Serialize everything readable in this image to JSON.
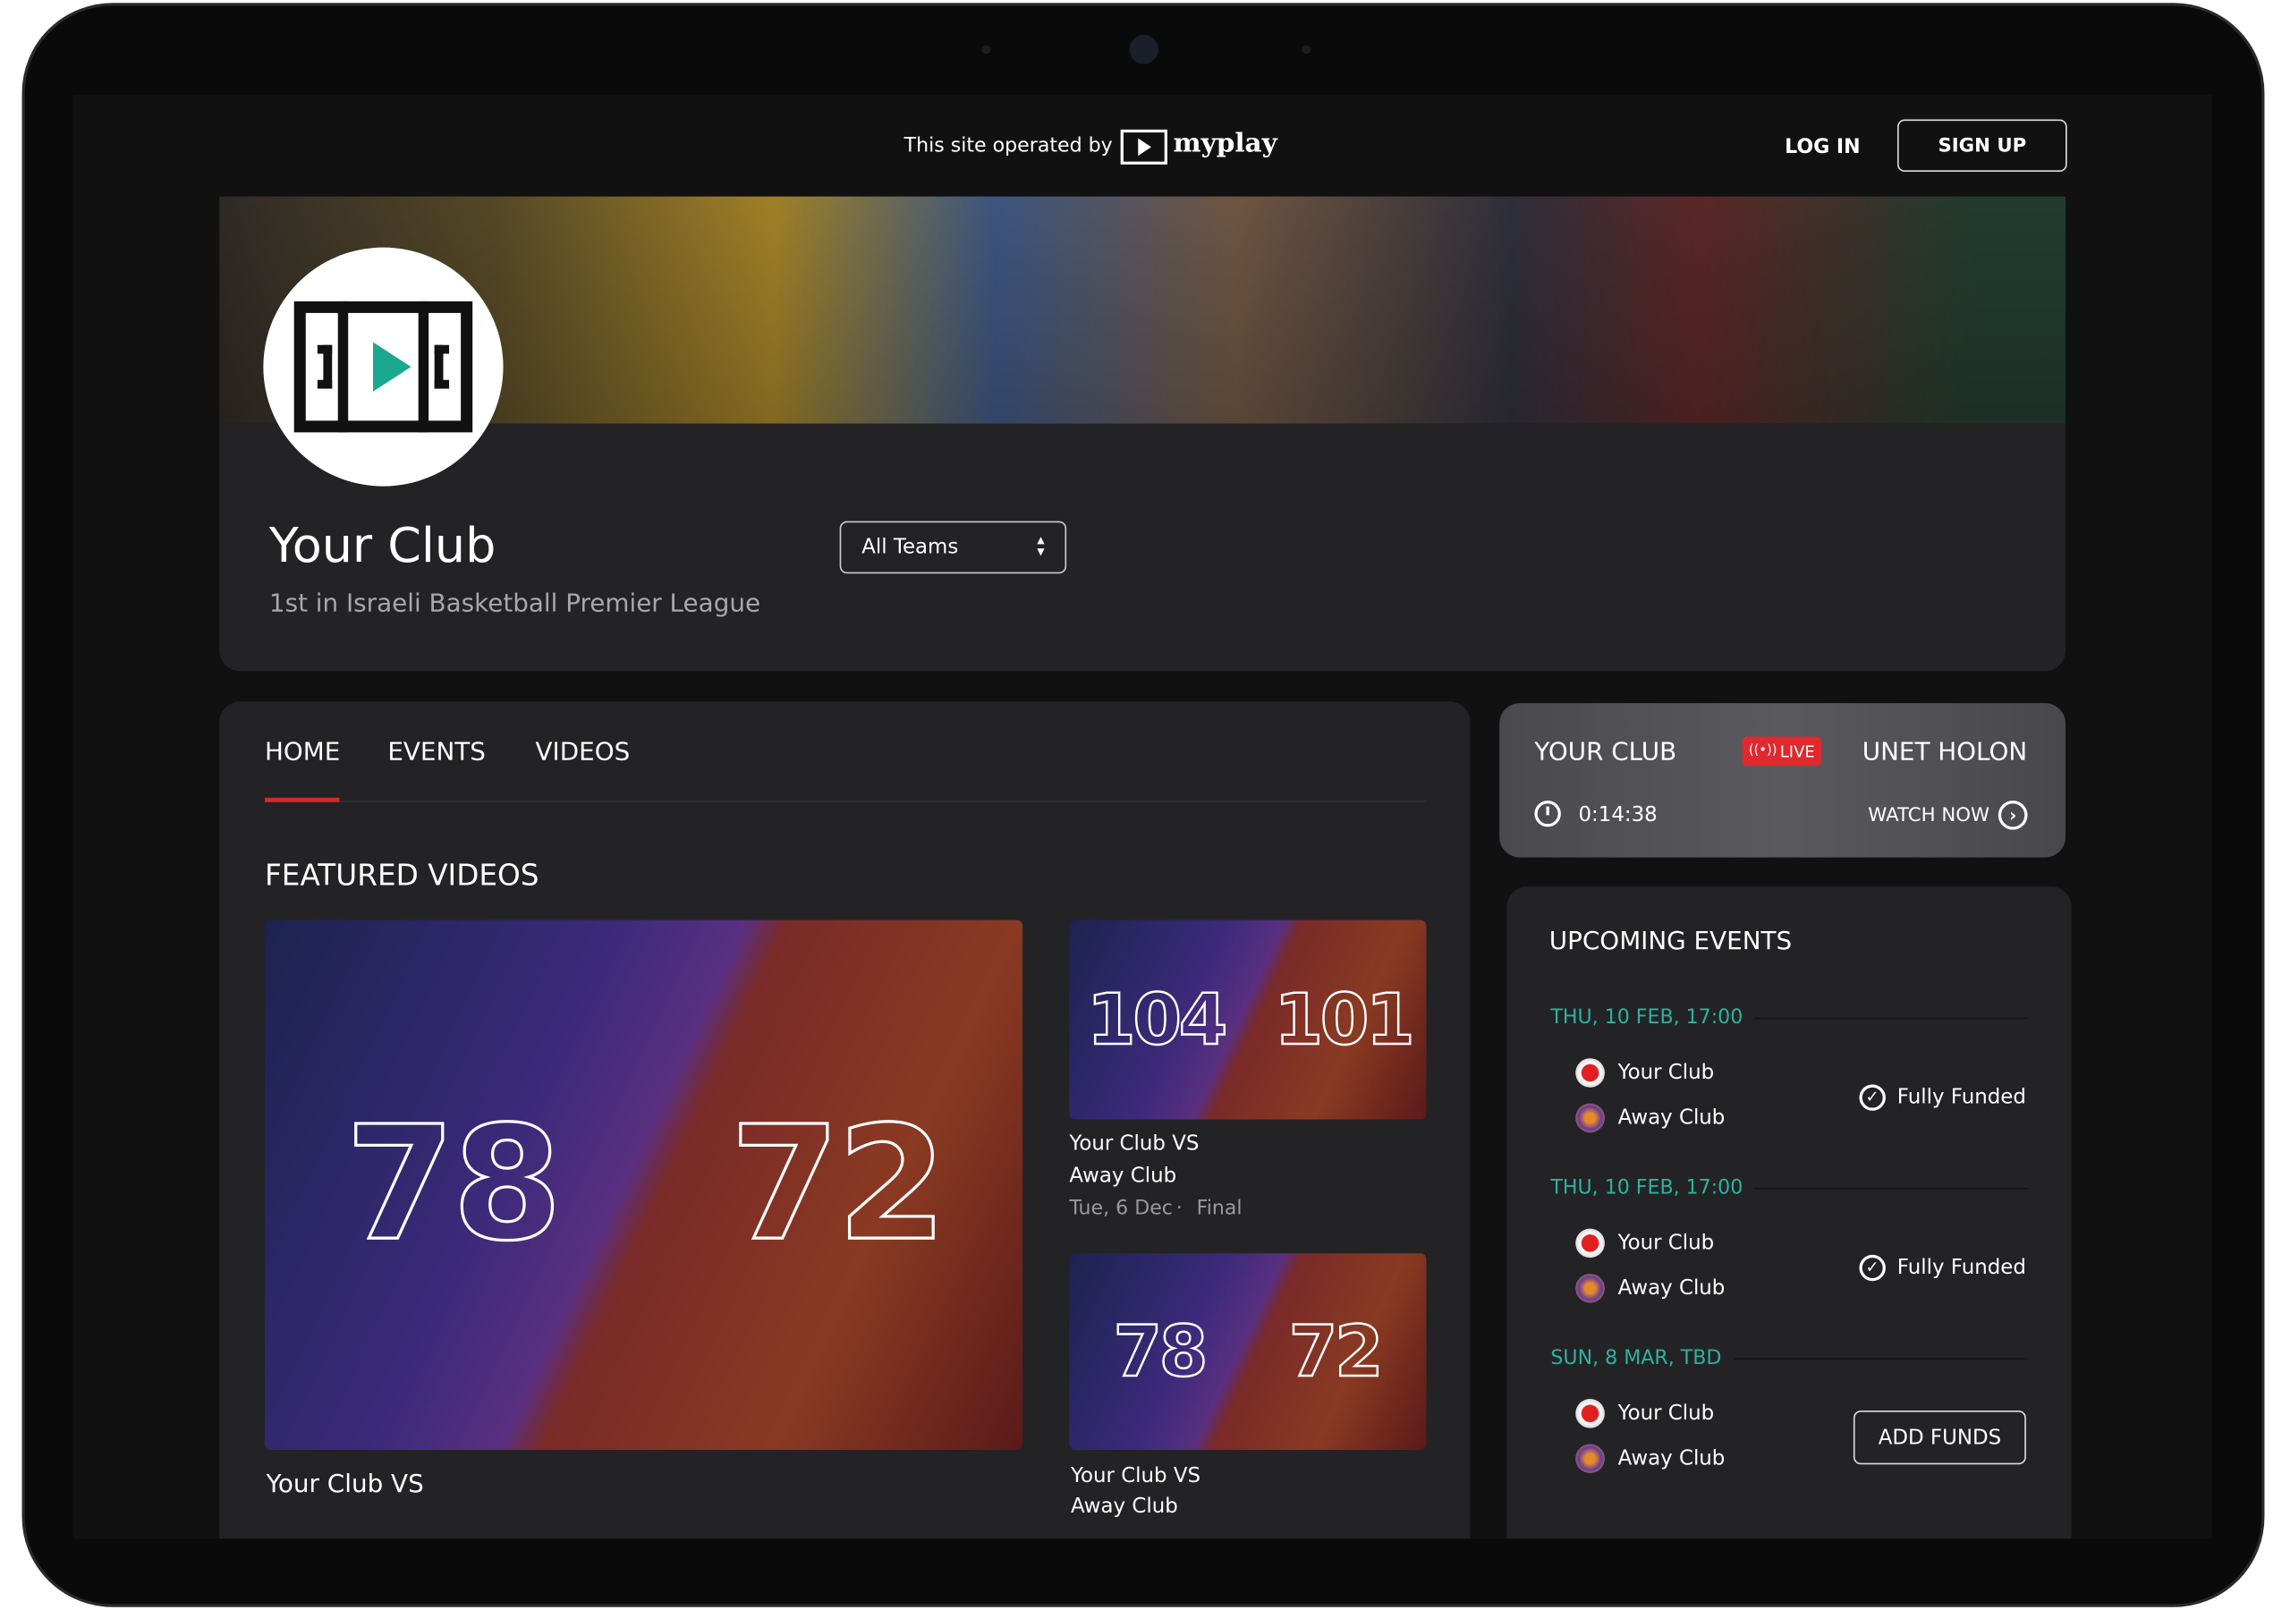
{
  "topbar": {
    "operated_by": "This site operated by",
    "brand": "myplay",
    "login": "LOG IN",
    "signup": "SIGN UP"
  },
  "club": {
    "name": "Your Club",
    "subtitle": "1st in Israeli Basketball Premier League",
    "team_select": "All Teams"
  },
  "tabs": [
    {
      "label": "HOME",
      "active": true
    },
    {
      "label": "EVENTS"
    },
    {
      "label": "VIDEOS"
    }
  ],
  "featured": {
    "title": "FEATURED VIDEOS",
    "videos": [
      {
        "home_score": "78",
        "away_score": "72",
        "title_line1": "Your Club VS"
      },
      {
        "home_score": "104",
        "away_score": "101",
        "title_line1": "Your Club VS",
        "title_line2": "Away Club",
        "date": "Tue, 6 Dec",
        "status": "Final"
      },
      {
        "home_score": "78",
        "away_score": "72",
        "title_line1": "Your Club VS",
        "title_line2": "Away Club"
      }
    ]
  },
  "live": {
    "home": "YOUR CLUB",
    "away": "UNET HOLON",
    "badge": "LIVE",
    "timer": "0:14:38",
    "watch": "WATCH NOW"
  },
  "upcoming": {
    "title": "UPCOMING EVENTS",
    "events": [
      {
        "date": "THU, 10 FEB, 17:00",
        "home": "Your Club",
        "away": "Away Club",
        "status": "Fully Funded"
      },
      {
        "date": "THU, 10 FEB, 17:00",
        "home": "Your Club",
        "away": "Away Club",
        "status": "Fully Funded"
      },
      {
        "date": "SUN, 8 MAR, TBD",
        "home": "Your Club",
        "away": "Away Club",
        "action": "ADD FUNDS"
      }
    ]
  },
  "colors": {
    "accent_red": "#d42a2a",
    "live_red": "#e0292e",
    "date_teal": "#2ab3a0",
    "card_bg": "#232325",
    "page_bg": "#111111"
  }
}
